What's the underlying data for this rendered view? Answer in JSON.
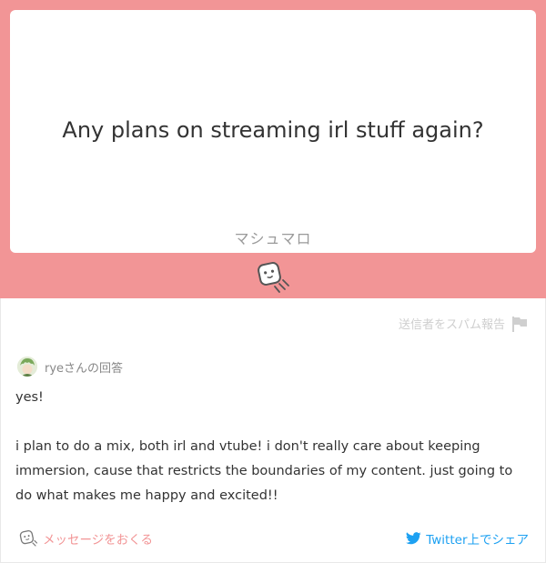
{
  "question": {
    "text": "Any plans on streaming irl stuff again?",
    "brand": "マシュマロ"
  },
  "report": {
    "label": "送信者をスパム報告"
  },
  "answerer": {
    "label": "ryeさんの回答"
  },
  "answer": {
    "text": "yes!\n\ni plan to do a mix, both irl and vtube! i don't really care about keeping immersion, cause that restricts the boundaries of my content. just going to do what makes me happy and excited!!"
  },
  "footer": {
    "send_message_label": "メッセージをおくる",
    "twitter_share_label": "Twitter上でシェア"
  },
  "colors": {
    "accent": "#f29596",
    "twitter": "#1da1f2"
  },
  "icons": {
    "mascot": "marshmallow-icon",
    "report": "flag-icon",
    "send": "marshmallow-icon",
    "share": "twitter-icon"
  }
}
